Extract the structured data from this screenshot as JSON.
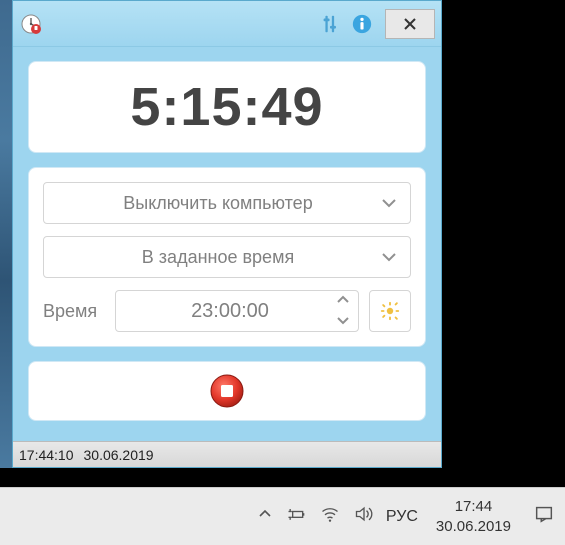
{
  "app": {
    "countdown": "5:15:49",
    "action_dropdown": "Выключить компьютер",
    "mode_dropdown": "В заданное время",
    "time_label": "Время",
    "time_value": "23:00:00",
    "status_time": "17:44:10",
    "status_date": "30.06.2019"
  },
  "taskbar": {
    "lang": "РУС",
    "clock_time": "17:44",
    "clock_date": "30.06.2019"
  }
}
